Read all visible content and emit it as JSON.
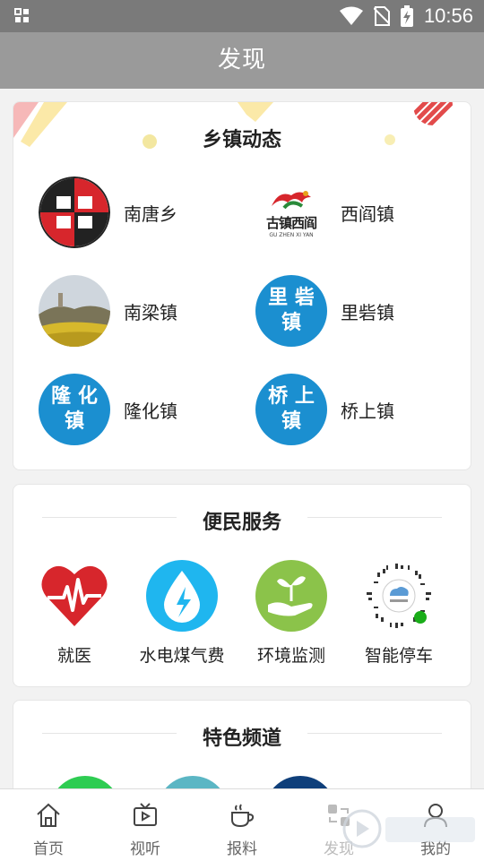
{
  "status": {
    "time": "10:56"
  },
  "header": {
    "title": "发现"
  },
  "towns": {
    "title": "乡镇动态",
    "items": [
      {
        "name": "南唐乡"
      },
      {
        "name": "西阎镇",
        "logo_text": "古镇西阎",
        "logo_sub": "GU  ZHEN  XI  YAN"
      },
      {
        "name": "南梁镇"
      },
      {
        "name": "里砦镇",
        "logo_line1": "里 砦",
        "logo_line2": "镇"
      },
      {
        "name": "隆化镇",
        "logo_line1": "隆 化",
        "logo_line2": "镇"
      },
      {
        "name": "桥上镇",
        "logo_line1": "桥 上",
        "logo_line2": "镇"
      }
    ]
  },
  "services": {
    "title": "便民服务",
    "items": [
      {
        "label": "就医",
        "icon": "heart-pulse-icon"
      },
      {
        "label": "水电煤气费",
        "icon": "water-power-icon"
      },
      {
        "label": "环境监测",
        "icon": "sprout-hand-icon"
      },
      {
        "label": "智能停车",
        "icon": "mini-program-qr-icon"
      }
    ]
  },
  "featured": {
    "title": "特色频道"
  },
  "tabbar": {
    "items": [
      {
        "label": "首页",
        "icon": "home-icon"
      },
      {
        "label": "视听",
        "icon": "tv-icon"
      },
      {
        "label": "报料",
        "icon": "coffee-cup-icon"
      },
      {
        "label": "发现",
        "icon": "discover-icon"
      },
      {
        "label": "我的",
        "icon": "user-icon"
      }
    ]
  },
  "colors": {
    "accent_blue": "#1b8fd0",
    "titlebar": "#9a9a9a",
    "statusbar": "#7a7a7a"
  }
}
